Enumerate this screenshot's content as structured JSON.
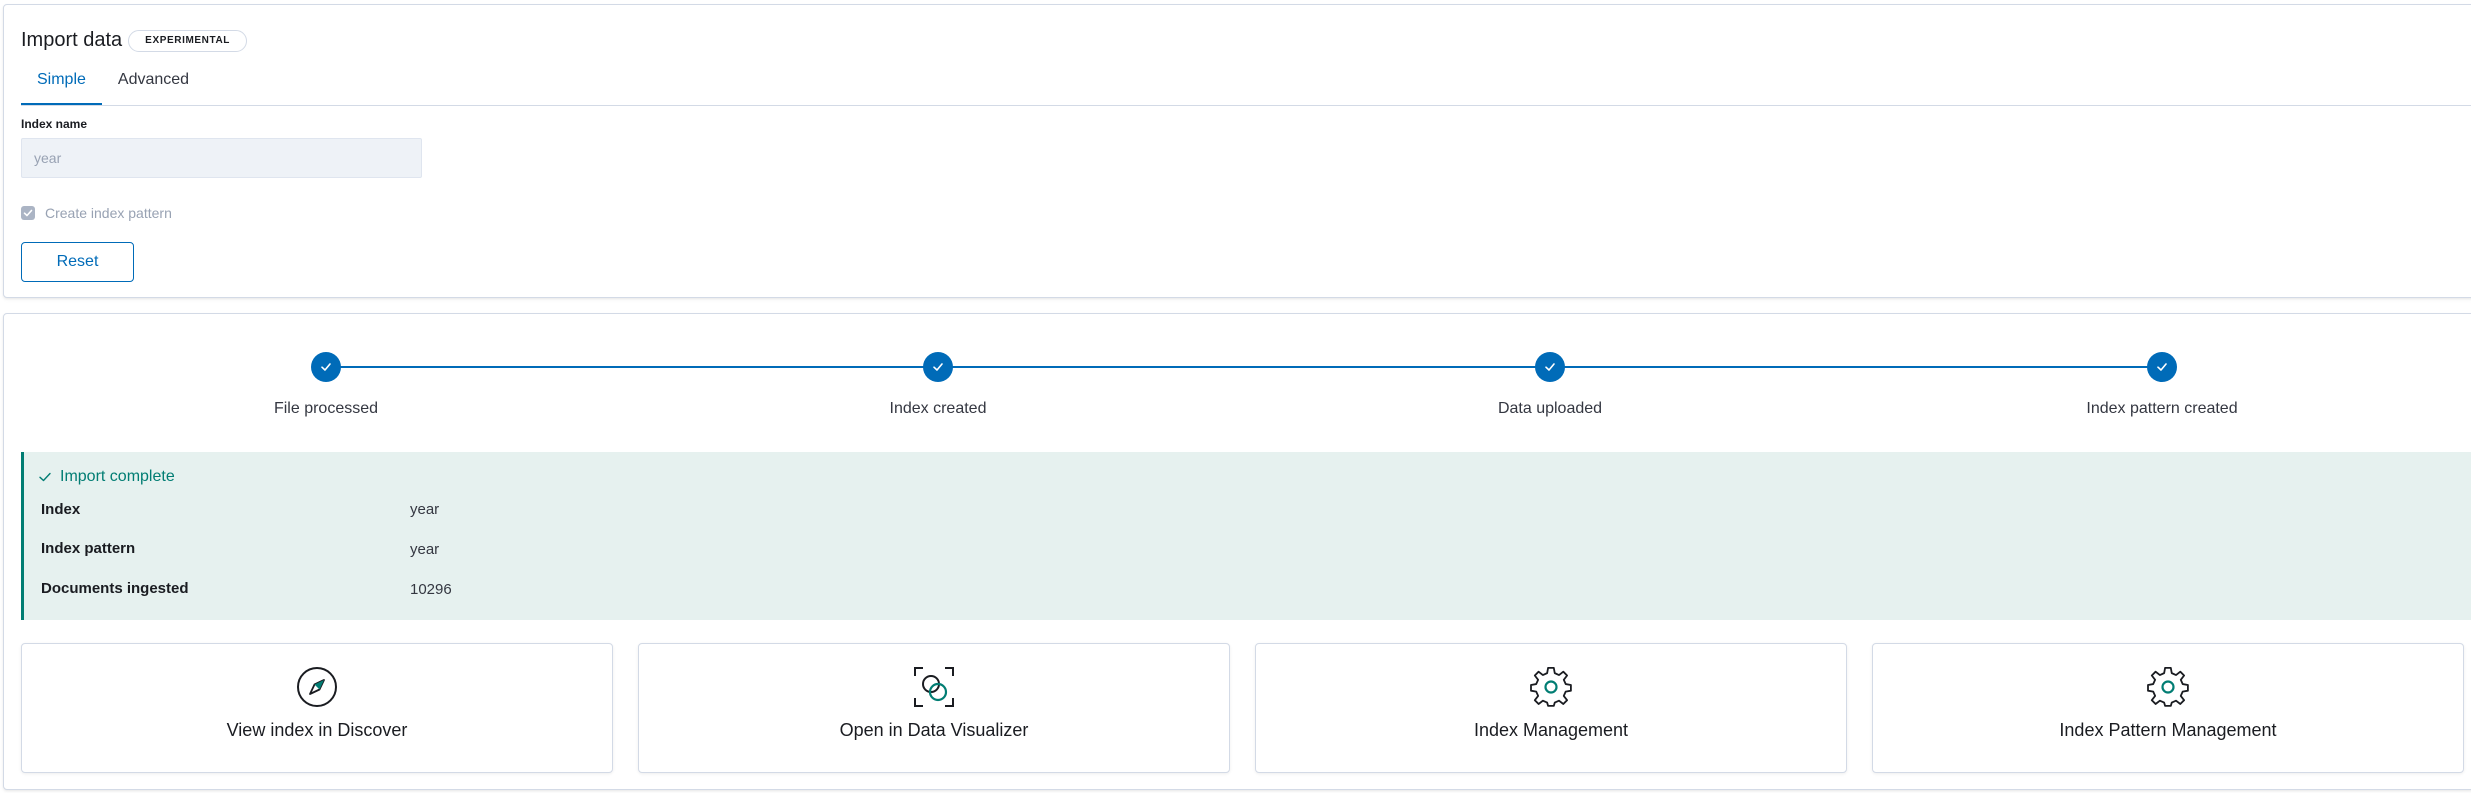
{
  "import_panel": {
    "title": "Import data",
    "badge": "EXPERIMENTAL",
    "tabs": [
      {
        "label": "Simple",
        "active": true
      },
      {
        "label": "Advanced",
        "active": false
      }
    ],
    "index_name_label": "Index name",
    "index_name_value": "year",
    "create_index_pattern_label": "Create index pattern",
    "create_index_pattern_checked": true,
    "reset_label": "Reset"
  },
  "steps": [
    {
      "title": "File processed",
      "status": "complete"
    },
    {
      "title": "Index created",
      "status": "complete"
    },
    {
      "title": "Data uploaded",
      "status": "complete"
    },
    {
      "title": "Index pattern created",
      "status": "complete"
    }
  ],
  "result": {
    "title": "Import complete",
    "rows": [
      {
        "key": "Index",
        "value": "year"
      },
      {
        "key": "Index pattern",
        "value": "year"
      },
      {
        "key": "Documents ingested",
        "value": "10296"
      }
    ]
  },
  "cards": [
    {
      "icon": "compass-icon",
      "label": "View index in Discover"
    },
    {
      "icon": "data-visualizer-icon",
      "label": "Open in Data Visualizer"
    },
    {
      "icon": "gear-icon",
      "label": "Index Management"
    },
    {
      "icon": "gear-icon",
      "label": "Index Pattern Management"
    }
  ],
  "colors": {
    "primary": "#006bb8",
    "success": "#017d73",
    "success_bg": "#e6f1ef"
  }
}
